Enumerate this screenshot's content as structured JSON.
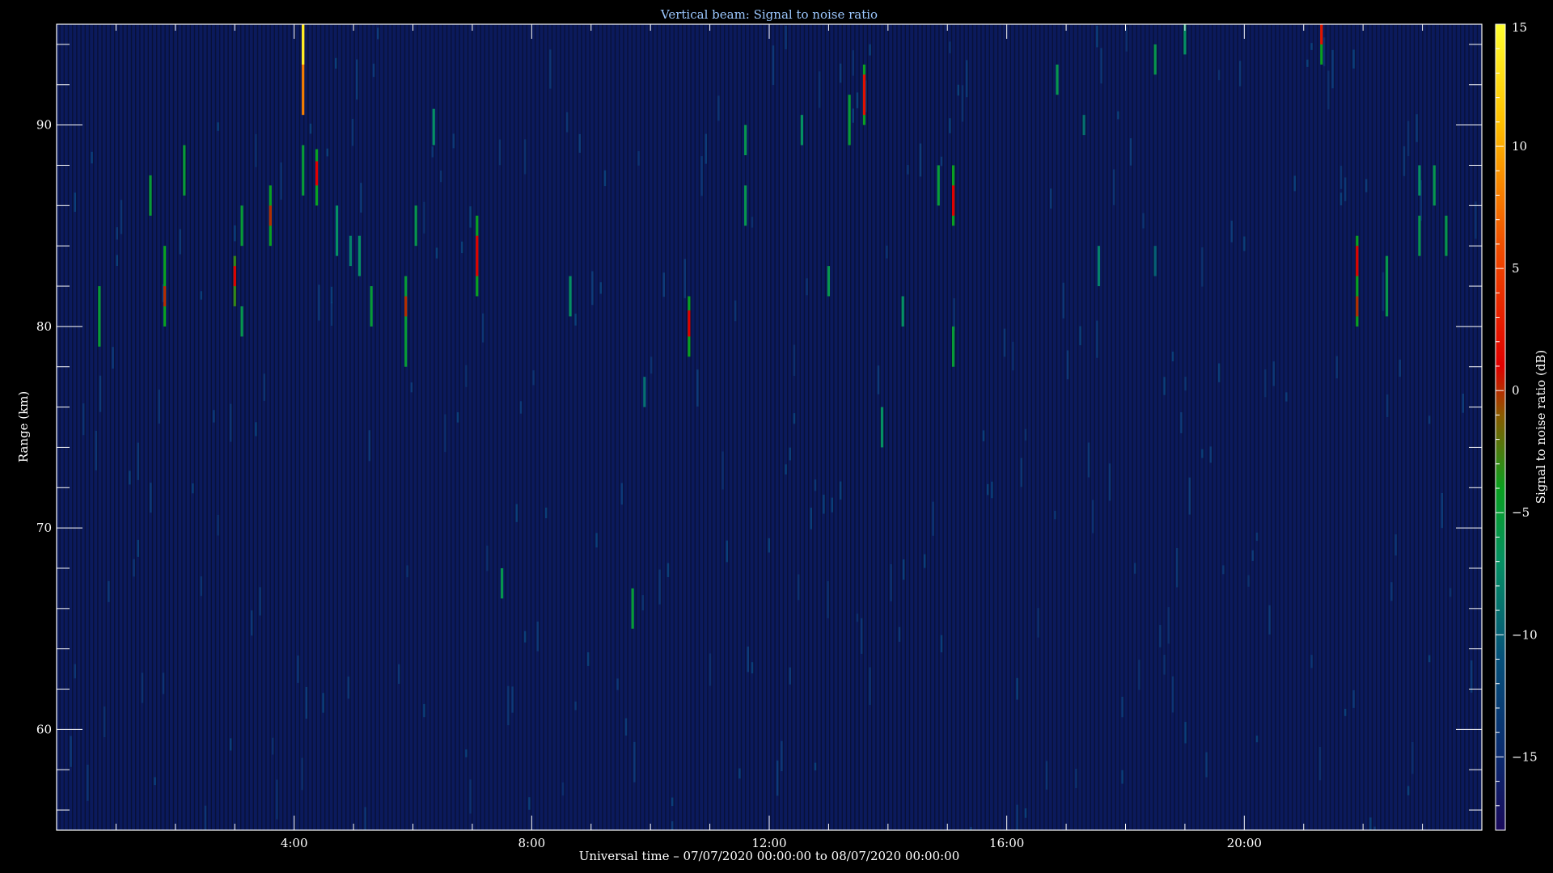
{
  "chart_data": {
    "type": "heatmap",
    "title": "Vertical beam: Signal to noise ratio",
    "xlabel": "Universal time – 07/07/2020 00:00:00 to 08/07/2020 00:00:00",
    "ylabel": "Range (km)",
    "colorbar_label": "Signal to noise ratio (dB)",
    "x_unit": "hours UT",
    "x_range": [
      0,
      24
    ],
    "y_range": [
      55,
      95
    ],
    "colorbar_range": [
      -18,
      15
    ],
    "x_ticks": [
      {
        "value": 4,
        "label": "4:00"
      },
      {
        "value": 8,
        "label": "8:00"
      },
      {
        "value": 12,
        "label": "12:00"
      },
      {
        "value": 16,
        "label": "16:00"
      },
      {
        "value": 20,
        "label": "20:00"
      }
    ],
    "y_ticks": [
      {
        "value": 60,
        "label": "60"
      },
      {
        "value": 70,
        "label": "70"
      },
      {
        "value": 80,
        "label": "80"
      },
      {
        "value": 90,
        "label": "90"
      }
    ],
    "colorbar_ticks": [
      {
        "value": -15,
        "label": "−15"
      },
      {
        "value": -10,
        "label": "−10"
      },
      {
        "value": -5,
        "label": "−5"
      },
      {
        "value": 0,
        "label": "0"
      },
      {
        "value": 5,
        "label": "5"
      },
      {
        "value": 10,
        "label": "10"
      },
      {
        "value": 15,
        "label": "15"
      }
    ],
    "colormap": [
      {
        "value": -18,
        "color": "#1a0a5a"
      },
      {
        "value": -15,
        "color": "#0a2a6e"
      },
      {
        "value": -11,
        "color": "#06507a"
      },
      {
        "value": -7,
        "color": "#059063"
      },
      {
        "value": -4,
        "color": "#0aa020"
      },
      {
        "value": -1,
        "color": "#8a5a00"
      },
      {
        "value": 1,
        "color": "#e00000"
      },
      {
        "value": 6,
        "color": "#f05000"
      },
      {
        "value": 11,
        "color": "#ffc000"
      },
      {
        "value": 15,
        "color": "#ffff30"
      }
    ],
    "background_color": "#0b1a5c",
    "background_snr": -16,
    "echoes": [
      {
        "t": 0.72,
        "range": [
          79,
          82
        ],
        "snr": -5
      },
      {
        "t": 1.58,
        "range": [
          85.5,
          87.5
        ],
        "snr": -5
      },
      {
        "t": 1.82,
        "range": [
          80,
          84
        ],
        "snr": -4
      },
      {
        "t": 1.82,
        "range": [
          81,
          82
        ],
        "snr": 0
      },
      {
        "t": 2.15,
        "range": [
          86.5,
          89
        ],
        "snr": -5
      },
      {
        "t": 3.0,
        "range": [
          81,
          83.5
        ],
        "snr": -3
      },
      {
        "t": 3.0,
        "range": [
          82,
          83
        ],
        "snr": 1
      },
      {
        "t": 3.12,
        "range": [
          84,
          86
        ],
        "snr": -5
      },
      {
        "t": 3.12,
        "range": [
          79.5,
          81
        ],
        "snr": -6
      },
      {
        "t": 3.6,
        "range": [
          84,
          87
        ],
        "snr": -4
      },
      {
        "t": 3.6,
        "range": [
          85,
          86
        ],
        "snr": 0
      },
      {
        "t": 4.15,
        "range": [
          90.5,
          95
        ],
        "snr": 8
      },
      {
        "t": 4.15,
        "range": [
          93,
          95
        ],
        "snr": 14
      },
      {
        "t": 4.15,
        "range": [
          86.5,
          89
        ],
        "snr": -5
      },
      {
        "t": 4.38,
        "range": [
          86,
          88.8
        ],
        "snr": -4
      },
      {
        "t": 4.38,
        "range": [
          87,
          88.2
        ],
        "snr": 1
      },
      {
        "t": 4.72,
        "range": [
          83.5,
          86
        ],
        "snr": -7
      },
      {
        "t": 4.95,
        "range": [
          83,
          84.5
        ],
        "snr": -8
      },
      {
        "t": 5.1,
        "range": [
          82.5,
          84.5
        ],
        "snr": -7
      },
      {
        "t": 5.3,
        "range": [
          80,
          82
        ],
        "snr": -5
      },
      {
        "t": 5.88,
        "range": [
          78,
          82.5
        ],
        "snr": -5
      },
      {
        "t": 5.88,
        "range": [
          80.5,
          81.5
        ],
        "snr": 0
      },
      {
        "t": 6.05,
        "range": [
          84,
          86
        ],
        "snr": -6
      },
      {
        "t": 6.35,
        "range": [
          89,
          90.8
        ],
        "snr": -7
      },
      {
        "t": 7.08,
        "range": [
          81.5,
          85.5
        ],
        "snr": -4
      },
      {
        "t": 7.08,
        "range": [
          82.5,
          84.5
        ],
        "snr": 1
      },
      {
        "t": 7.5,
        "range": [
          66.5,
          68
        ],
        "snr": -6
      },
      {
        "t": 8.65,
        "range": [
          80.5,
          82.5
        ],
        "snr": -7
      },
      {
        "t": 9.7,
        "range": [
          65,
          67
        ],
        "snr": -5
      },
      {
        "t": 9.9,
        "range": [
          76,
          77.5
        ],
        "snr": -9
      },
      {
        "t": 10.65,
        "range": [
          78.5,
          81.5
        ],
        "snr": -4
      },
      {
        "t": 10.65,
        "range": [
          79.5,
          80.8
        ],
        "snr": 1
      },
      {
        "t": 11.6,
        "range": [
          88.5,
          90
        ],
        "snr": -6
      },
      {
        "t": 11.6,
        "range": [
          85,
          87
        ],
        "snr": -6
      },
      {
        "t": 12.55,
        "range": [
          89,
          90.5
        ],
        "snr": -7
      },
      {
        "t": 13.0,
        "range": [
          81.5,
          83
        ],
        "snr": -6
      },
      {
        "t": 13.35,
        "range": [
          89,
          91.5
        ],
        "snr": -5
      },
      {
        "t": 13.6,
        "range": [
          90,
          93
        ],
        "snr": -4
      },
      {
        "t": 13.6,
        "range": [
          90.5,
          92.5
        ],
        "snr": 2
      },
      {
        "t": 13.9,
        "range": [
          74,
          76
        ],
        "snr": -7
      },
      {
        "t": 14.25,
        "range": [
          80,
          81.5
        ],
        "snr": -7
      },
      {
        "t": 14.85,
        "range": [
          86,
          88
        ],
        "snr": -5
      },
      {
        "t": 15.1,
        "range": [
          85,
          88
        ],
        "snr": -4
      },
      {
        "t": 15.1,
        "range": [
          85.5,
          87
        ],
        "snr": 1
      },
      {
        "t": 15.1,
        "range": [
          78,
          80
        ],
        "snr": -5
      },
      {
        "t": 16.85,
        "range": [
          91.5,
          93
        ],
        "snr": -6
      },
      {
        "t": 17.3,
        "range": [
          89.5,
          90.5
        ],
        "snr": -9
      },
      {
        "t": 17.55,
        "range": [
          82,
          84
        ],
        "snr": -8
      },
      {
        "t": 18.5,
        "range": [
          92.5,
          94
        ],
        "snr": -6
      },
      {
        "t": 18.5,
        "range": [
          82.5,
          84
        ],
        "snr": -10
      },
      {
        "t": 19.0,
        "range": [
          93.5,
          95
        ],
        "snr": -7
      },
      {
        "t": 21.3,
        "range": [
          93,
          95
        ],
        "snr": -4
      },
      {
        "t": 21.3,
        "range": [
          94,
          95
        ],
        "snr": 2
      },
      {
        "t": 21.9,
        "range": [
          80,
          84.5
        ],
        "snr": -4
      },
      {
        "t": 21.9,
        "range": [
          82.5,
          84
        ],
        "snr": 1
      },
      {
        "t": 21.9,
        "range": [
          80.5,
          81.5
        ],
        "snr": 0
      },
      {
        "t": 22.4,
        "range": [
          80.5,
          83.5
        ],
        "snr": -6
      },
      {
        "t": 22.95,
        "range": [
          83.5,
          85.5
        ],
        "snr": -6
      },
      {
        "t": 22.95,
        "range": [
          86.5,
          88
        ],
        "snr": -7
      },
      {
        "t": 23.2,
        "range": [
          86,
          88
        ],
        "snr": -6
      },
      {
        "t": 23.4,
        "range": [
          83.5,
          85.5
        ],
        "snr": -6
      }
    ]
  }
}
